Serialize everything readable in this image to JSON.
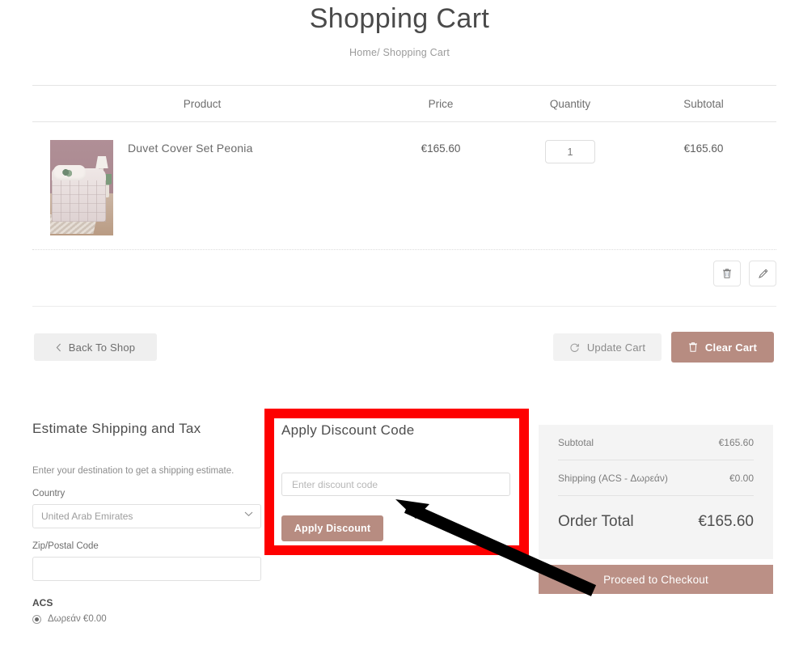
{
  "header": {
    "title": "Shopping Cart",
    "breadcrumb_home": "Home/",
    "breadcrumb_current": "Shopping Cart"
  },
  "cart_table": {
    "columns": [
      "Product",
      "Price",
      "Quantity",
      "Subtotal"
    ],
    "rows": [
      {
        "name": "Duvet Cover Set Peonia",
        "price": "€165.60",
        "quantity": "1",
        "subtotal": "€165.60"
      }
    ],
    "row_actions": {
      "delete_icon": "trash-icon",
      "edit_icon": "pencil-icon"
    }
  },
  "cart_actions": {
    "back_to_shop": "Back To Shop",
    "back_icon": "chevron-left-icon",
    "update_cart": "Update Cart",
    "update_icon": "refresh-icon",
    "clear_cart": "Clear Cart",
    "clear_icon": "trash-icon"
  },
  "shipping": {
    "title": "Estimate Shipping and Tax",
    "description": "Enter your destination to get a shipping estimate.",
    "country_label": "Country",
    "country_value": "United Arab Emirates",
    "zip_label": "Zip/Postal Code",
    "zip_value": "",
    "zip_placeholder": "",
    "carrier": "ACS",
    "carrier_option": "Δωρεάν €0.00"
  },
  "discount": {
    "title": "Apply Discount Code",
    "input_value": "",
    "input_placeholder": "Enter discount code",
    "button_label": "Apply Discount"
  },
  "summary": {
    "subtotal_label": "Subtotal",
    "subtotal_value": "€165.60",
    "shipping_label": "Shipping (ACS - Δωρεάν)",
    "shipping_value": "€0.00",
    "total_label": "Order Total",
    "total_value": "€165.60",
    "checkout_label": "Proceed to Checkout"
  },
  "annotation": {
    "highlight_color": "#fe0000",
    "arrow_color": "#000000",
    "accent_color": "#b78c81"
  }
}
